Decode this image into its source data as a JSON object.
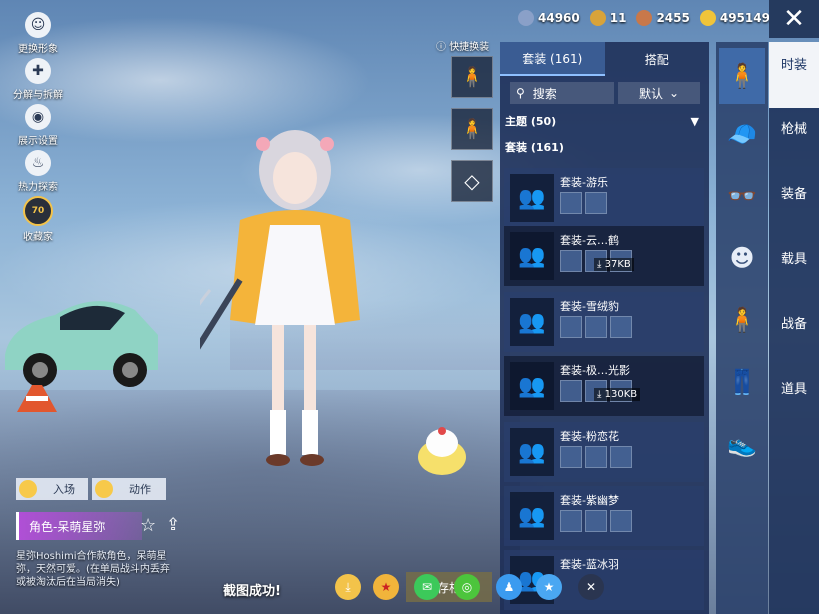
{
  "left_menu": [
    {
      "label": "更换形象",
      "icon": "avatar-icon"
    },
    {
      "label": "分解与拆解",
      "icon": "puzzle-icon"
    },
    {
      "label": "展示设置",
      "icon": "eye-icon"
    },
    {
      "label": "热力探索",
      "icon": "flame-icon"
    },
    {
      "label": "收藏家",
      "icon": "collector-badge-icon",
      "badge": "70"
    }
  ],
  "currencies": [
    {
      "value": "44960",
      "color": "#8aa0c8",
      "icon": "silver-coin-icon"
    },
    {
      "value": "11",
      "color": "#d8a33a",
      "icon": "crown-coin-icon"
    },
    {
      "value": "2455",
      "color": "#c8784a",
      "icon": "bronze-coin-icon"
    },
    {
      "value": "495149",
      "color": "#f0c43a",
      "icon": "uc-coin-icon"
    }
  ],
  "quick_swap": {
    "label": "快捷换装"
  },
  "panel": {
    "tabs": [
      "套装 (161)",
      "搭配"
    ],
    "search_label": "搜索",
    "sort_label": "默认",
    "section_theme": "主题 (50)",
    "section_outfits": "套装 (161)",
    "outfits": [
      {
        "name": "套装-游乐",
        "size": "",
        "dim": false
      },
      {
        "name": "套装-云…鹤",
        "size": "37KB",
        "dim": true
      },
      {
        "name": "套装-雪绒豹",
        "size": "",
        "dim": false
      },
      {
        "name": "套装-极…光影",
        "size": "130KB",
        "dim": true
      },
      {
        "name": "套装-粉恋花",
        "size": "",
        "dim": false
      },
      {
        "name": "套装-紫幽梦",
        "size": "",
        "dim": false
      },
      {
        "name": "套装-蓝冰羽",
        "size": "",
        "dim": false
      }
    ]
  },
  "categories": [
    {
      "label": "时装",
      "icon": "outfit-icon",
      "active": true
    },
    {
      "label": "枪械",
      "icon": "cap-icon",
      "active": false
    },
    {
      "label": "装备",
      "icon": "glasses-icon",
      "active": false
    },
    {
      "label": "载具",
      "icon": "mask-icon",
      "active": false
    },
    {
      "label": "战备",
      "icon": "character-icon",
      "active": false
    },
    {
      "label": "道具",
      "icon": "pants-icon",
      "active": false
    },
    {
      "label": "",
      "icon": "shoes-icon",
      "active": false
    }
  ],
  "bottom": {
    "entry_label": "入场",
    "action_label": "动作",
    "character_name": "角色-呆萌星弥",
    "description": "星弥Hoshimi合作款角色，呆萌星弥，天然可爱。(在单局战斗内丢弃或被淘汰后在当局消失)",
    "success_text": "截图成功!",
    "save_label": "存相"
  }
}
